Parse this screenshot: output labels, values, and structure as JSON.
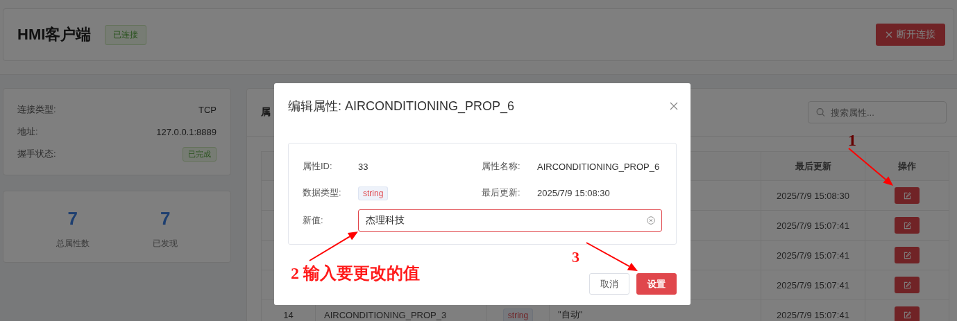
{
  "header": {
    "title": "HMI客户端",
    "status": "已连接",
    "disconnect_button": "断开连接"
  },
  "connection": [
    {
      "label": "连接类型:",
      "value": "TCP",
      "kind": "text"
    },
    {
      "label": "地址:",
      "value": "127.0.0.1:8889",
      "kind": "text"
    },
    {
      "label": "握手状态:",
      "value": "已完成",
      "kind": "tag"
    }
  ],
  "stats": [
    {
      "value": "7",
      "label": "总属性数"
    },
    {
      "value": "7",
      "label": "已发现"
    }
  ],
  "properties_panel": {
    "title": "属",
    "search": {
      "placeholder": "搜索属性..."
    },
    "table": {
      "columns": [
        "最后更新",
        "操作"
      ],
      "rows": [
        {
          "updated": "2025/7/9 15:08:30"
        },
        {
          "updated": "2025/7/9 15:07:41"
        },
        {
          "updated": "2025/7/9 15:07:41"
        },
        {
          "updated": "2025/7/9 15:07:41"
        },
        {
          "index": "14",
          "name": "AIRCONDITIONING_PROP_3",
          "type": "string",
          "value": "\"自动\"",
          "updated": "2025/7/9 15:07:41"
        }
      ]
    }
  },
  "dialog": {
    "title": "编辑属性: AIRCONDITIONING_PROP_6",
    "fields": [
      {
        "label": "属性ID:",
        "value": "33",
        "kind": "text"
      },
      {
        "label": "属性名称:",
        "value": "AIRCONDITIONING_PROP_6",
        "kind": "text"
      },
      {
        "label": "数据类型:",
        "value": "string",
        "kind": "tag"
      },
      {
        "label": "最后更新:",
        "value": "2025/7/9 15:08:30",
        "kind": "text"
      }
    ],
    "new_value": {
      "label": "新值:",
      "value": "杰理科技"
    },
    "buttons": [
      {
        "label": "取消",
        "kind": "default"
      },
      {
        "label": "设置",
        "kind": "primary"
      }
    ]
  },
  "annotations": [
    {
      "label": "1"
    },
    {
      "label": "2 输入要更改的值"
    },
    {
      "label": "3"
    }
  ]
}
